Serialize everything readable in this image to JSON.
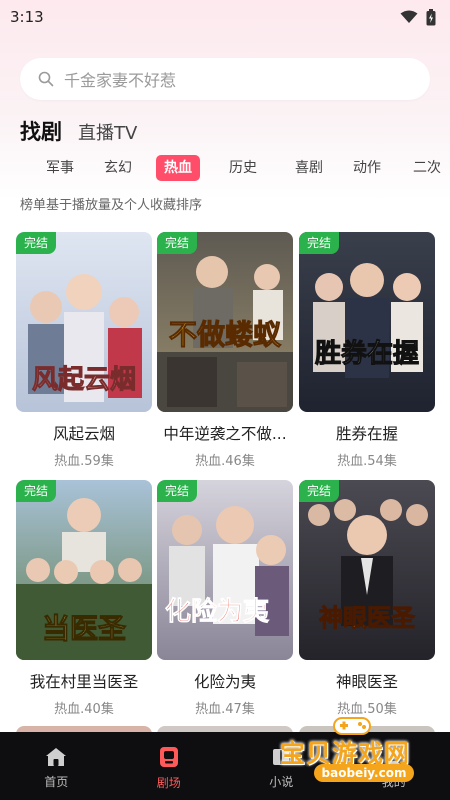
{
  "status": {
    "time": "3:13"
  },
  "search": {
    "placeholder": "千金家妻不好惹"
  },
  "top_tabs": [
    "找剧",
    "直播TV"
  ],
  "genres": [
    {
      "label": "军事",
      "active": false
    },
    {
      "label": "玄幻",
      "active": false
    },
    {
      "label": "热血",
      "active": true
    },
    {
      "label": "历史",
      "active": false
    },
    {
      "label": "喜剧",
      "active": false
    },
    {
      "label": "动作",
      "active": false
    },
    {
      "label": "二次",
      "active": false
    }
  ],
  "rank_note": "榜单基于播放量及个人收藏排序",
  "dramas": [
    {
      "badge": "完结",
      "title": "风起云烟",
      "meta": "热血.59集",
      "poster_text": "风起云烟",
      "poster_color": "#c8d3e6"
    },
    {
      "badge": "完结",
      "title": "中年逆袭之不做...",
      "meta": "热血.46集",
      "poster_text": "不做蝼蚁",
      "poster_color": "#8b7d63"
    },
    {
      "badge": "完结",
      "title": "胜券在握",
      "meta": "热血.54集",
      "poster_text": "胜券在握",
      "poster_color": "#2b3140"
    },
    {
      "badge": "完结",
      "title": "我在村里当医圣",
      "meta": "热血.40集",
      "poster_text": "当医圣",
      "poster_color": "#7b9a6b"
    },
    {
      "badge": "完结",
      "title": "化险为夷",
      "meta": "热血.47集",
      "poster_text": "化险为夷",
      "poster_color": "#a9a6b4"
    },
    {
      "badge": "完结",
      "title": "神眼医圣",
      "meta": "热血.50集",
      "poster_text": "神眼医圣",
      "poster_color": "#3c3a40"
    }
  ],
  "nav": [
    {
      "label": "首页",
      "icon": "home-icon",
      "active": false
    },
    {
      "label": "剧场",
      "icon": "theater-icon",
      "active": true
    },
    {
      "label": "小说",
      "icon": "book-icon",
      "active": false
    },
    {
      "label": "我的",
      "icon": "profile-icon",
      "active": false
    }
  ],
  "watermark": {
    "text": "宝贝游戏网",
    "url": "baobeiy.com"
  },
  "colors": {
    "accent": "#ff4d6a",
    "badge": "#2bb24c",
    "nav_bg": "#0e0e10",
    "nav_active": "#ff5a5a"
  }
}
